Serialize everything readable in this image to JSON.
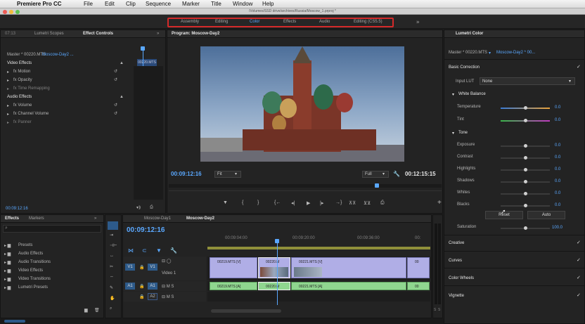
{
  "menubar": {
    "apple_glyph": "",
    "app_name": "Premiere Pro CC",
    "items": [
      "File",
      "Edit",
      "Clip",
      "Sequence",
      "Marker",
      "Title",
      "Window",
      "Help"
    ]
  },
  "titlebar": {
    "path": "/Volumes/SSD drive/archives/Russia/Moscow_1.prproj *"
  },
  "workspaces": {
    "tabs": [
      "Assembly",
      "Editing",
      "Color",
      "Effects",
      "Audio",
      "Editing (CS5.5)"
    ],
    "active": "Color",
    "more": "»",
    "highlight_color": "#d42a2a"
  },
  "source_panel": {
    "tabs": [
      "07:13",
      "Lumetri Scopes",
      "Effect Controls",
      "»"
    ],
    "master": "Master * 00220.MTS",
    "sequence": "Moscow-Day2 ...",
    "clip_label": "00220.MTS",
    "sections": [
      {
        "label": "Video Effects"
      },
      {
        "label": "fx  Motion"
      },
      {
        "label": "fx  Opacity"
      },
      {
        "label": "fx  Time Remapping"
      },
      {
        "label": "Audio Effects"
      },
      {
        "label": "fx  Volume"
      },
      {
        "label": "fx  Channel Volume"
      },
      {
        "label": "fx  Panner"
      }
    ],
    "timecode": "00:09:12:16"
  },
  "program_monitor": {
    "title": "Program: Moscow-Day2",
    "timecode_current": "00:09:12:16",
    "fit": "Fit",
    "full": "Full",
    "timecode_end": "00:12:15:15"
  },
  "lumetri": {
    "tab": "Lumetri Color",
    "master": "Master * 00220.MTS",
    "sequence": "Moscow-Day2 * 00...",
    "basic_correction": "Basic Correction",
    "input_lut_label": "Input LUT",
    "input_lut_value": "None",
    "white_balance": "White Balance",
    "temperature_label": "Temperature",
    "temperature_value": "0.0",
    "tint_label": "Tint",
    "tint_value": "0.0",
    "tone": "Tone",
    "tone_controls": [
      {
        "label": "Exposure",
        "value": "0.0"
      },
      {
        "label": "Contrast",
        "value": "0.0"
      },
      {
        "label": "Highlights",
        "value": "0.0"
      },
      {
        "label": "Shadows",
        "value": "0.0"
      },
      {
        "label": "Whites",
        "value": "0.0"
      },
      {
        "label": "Blacks",
        "value": "0.0"
      }
    ],
    "reset": "Reset",
    "auto": "Auto",
    "saturation_label": "Saturation",
    "saturation_value": "100.0",
    "sections": [
      "Creative",
      "Curves",
      "Color Wheels",
      "Vignette"
    ]
  },
  "effects_panel": {
    "tabs": [
      "Effects",
      "Markers",
      "»"
    ],
    "items": [
      "Presets",
      "Audio Effects",
      "Audio Transitions",
      "Video Effects",
      "Video Transitions",
      "Lumetri Presets"
    ]
  },
  "timeline": {
    "tabs": [
      "Moscow-Day1",
      "Moscow-Day2"
    ],
    "timecode": "00:09:12:16",
    "ruler": [
      "00:09:04:00",
      "00:09:20:00",
      "00:09:36:00",
      "00:"
    ],
    "tracks": [
      {
        "id": "V1",
        "name": "Video 1"
      },
      {
        "id": "A1",
        "name": ""
      },
      {
        "id": "A2",
        "name": ""
      }
    ],
    "video_clips": [
      "00219.MTS [V]",
      "00220.M",
      "00221.MTS [V]",
      "00"
    ],
    "audio_clips": [
      "00219.MTS [A]",
      "00220.M",
      "00221.MTS [A]",
      "00"
    ],
    "meter_labels": [
      "S",
      "S"
    ]
  }
}
